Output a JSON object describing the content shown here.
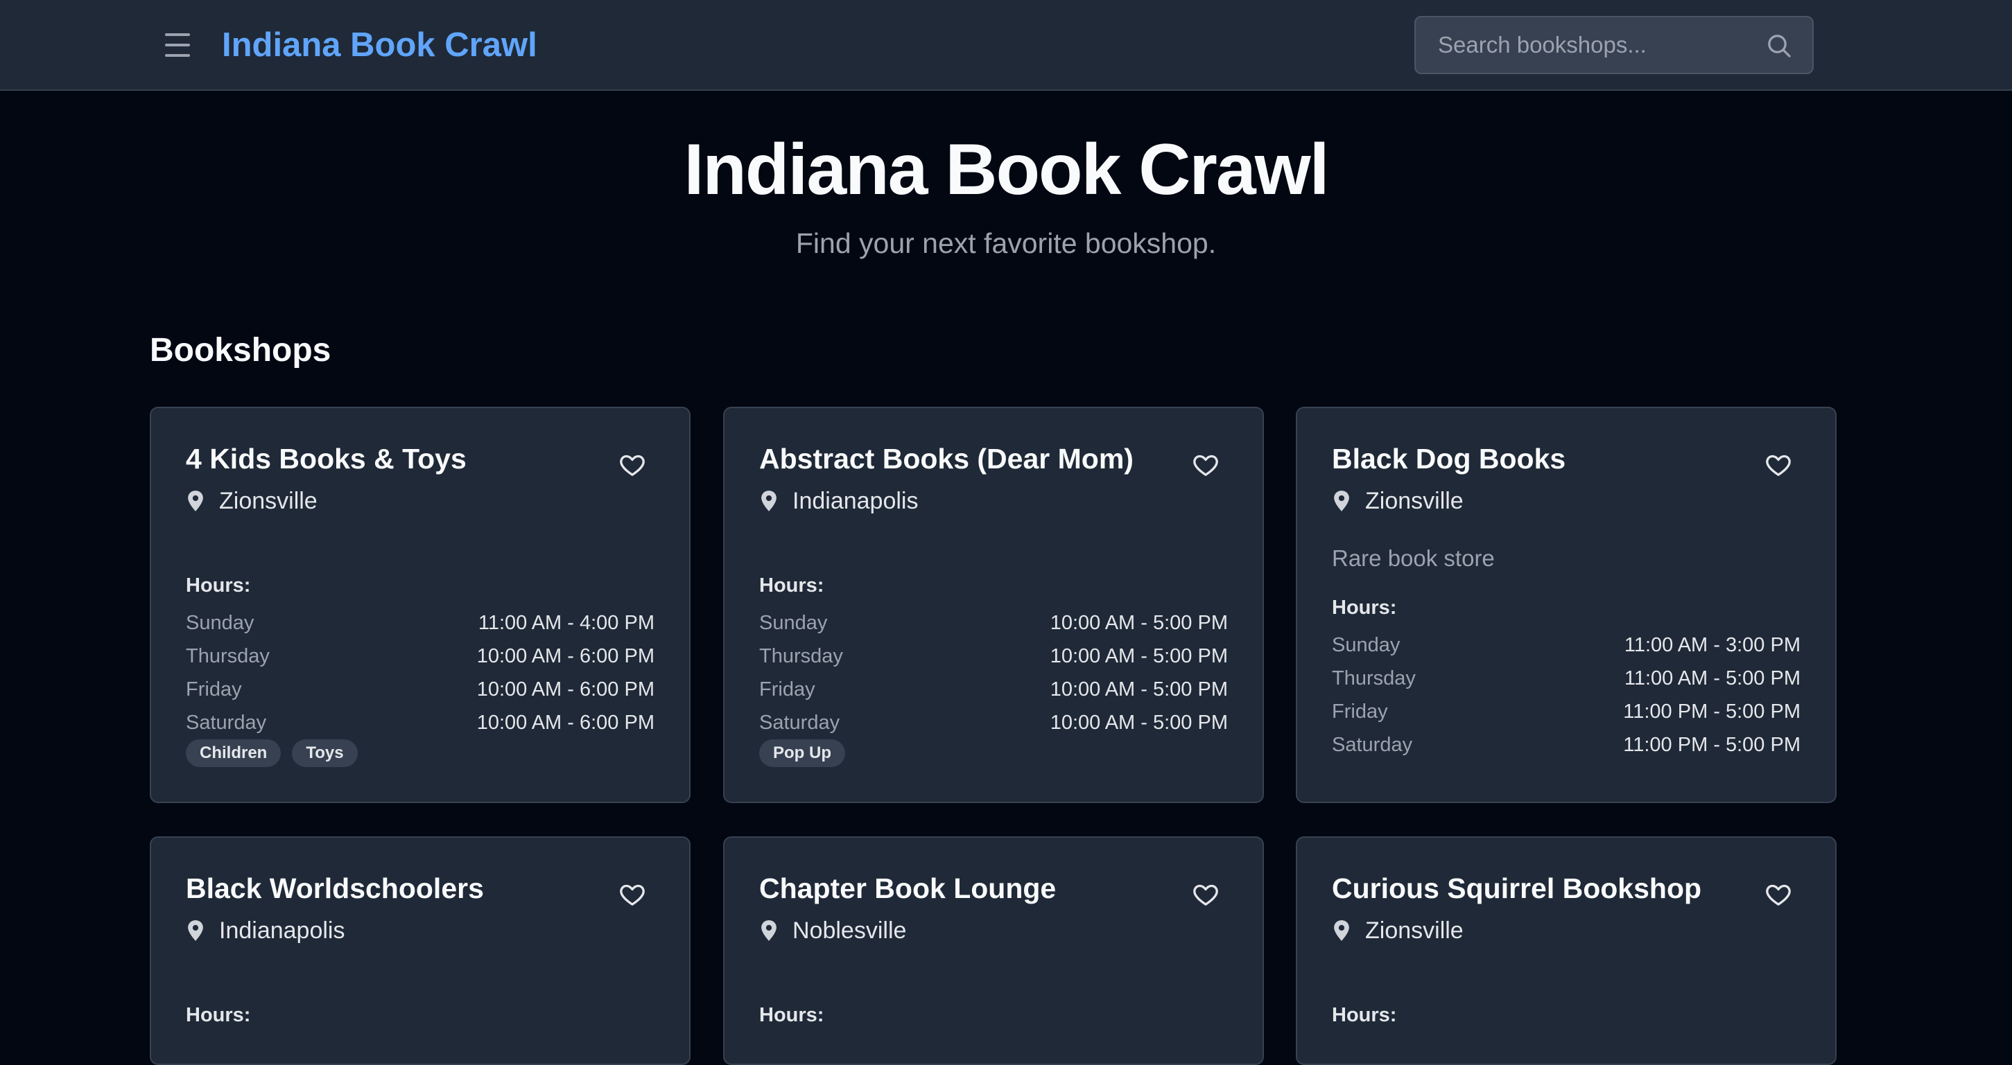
{
  "header": {
    "brand": "Indiana Book Crawl",
    "search_placeholder": "Search bookshops...",
    "icons": {
      "menu": "hamburger-menu-icon",
      "search": "search-icon"
    }
  },
  "hero": {
    "title": "Indiana Book Crawl",
    "subtitle": "Find your next favorite bookshop."
  },
  "section": {
    "title": "Bookshops"
  },
  "hours_label": "Hours:",
  "colors": {
    "background": "#030712",
    "card": "#1f2937",
    "accent": "#60a5fa"
  },
  "shops": [
    {
      "name": "4 Kids Books & Toys",
      "city": "Zionsville",
      "hours": [
        {
          "day": "Sunday",
          "time": "11:00 AM - 4:00 PM"
        },
        {
          "day": "Thursday",
          "time": "10:00 AM - 6:00 PM"
        },
        {
          "day": "Friday",
          "time": "10:00 AM - 6:00 PM"
        },
        {
          "day": "Saturday",
          "time": "10:00 AM - 6:00 PM"
        }
      ],
      "tags": [
        "Children",
        "Toys"
      ]
    },
    {
      "name": "Abstract Books (Dear Mom)",
      "city": "Indianapolis",
      "hours": [
        {
          "day": "Sunday",
          "time": "10:00 AM - 5:00 PM"
        },
        {
          "day": "Thursday",
          "time": "10:00 AM - 5:00 PM"
        },
        {
          "day": "Friday",
          "time": "10:00 AM - 5:00 PM"
        },
        {
          "day": "Saturday",
          "time": "10:00 AM - 5:00 PM"
        }
      ],
      "tags": [
        "Pop Up"
      ]
    },
    {
      "name": "Black Dog Books",
      "city": "Zionsville",
      "description": "Rare book store",
      "hours": [
        {
          "day": "Sunday",
          "time": "11:00 AM - 3:00 PM"
        },
        {
          "day": "Thursday",
          "time": "11:00 AM - 5:00 PM"
        },
        {
          "day": "Friday",
          "time": "11:00 PM - 5:00 PM"
        },
        {
          "day": "Saturday",
          "time": "11:00 PM - 5:00 PM"
        }
      ],
      "tags": []
    },
    {
      "name": "Black Worldschoolers",
      "city": "Indianapolis",
      "hours": [],
      "tags": []
    },
    {
      "name": "Chapter Book Lounge",
      "city": "Noblesville",
      "hours": [],
      "tags": []
    },
    {
      "name": "Curious Squirrel Bookshop",
      "city": "Zionsville",
      "hours": [],
      "tags": []
    }
  ]
}
